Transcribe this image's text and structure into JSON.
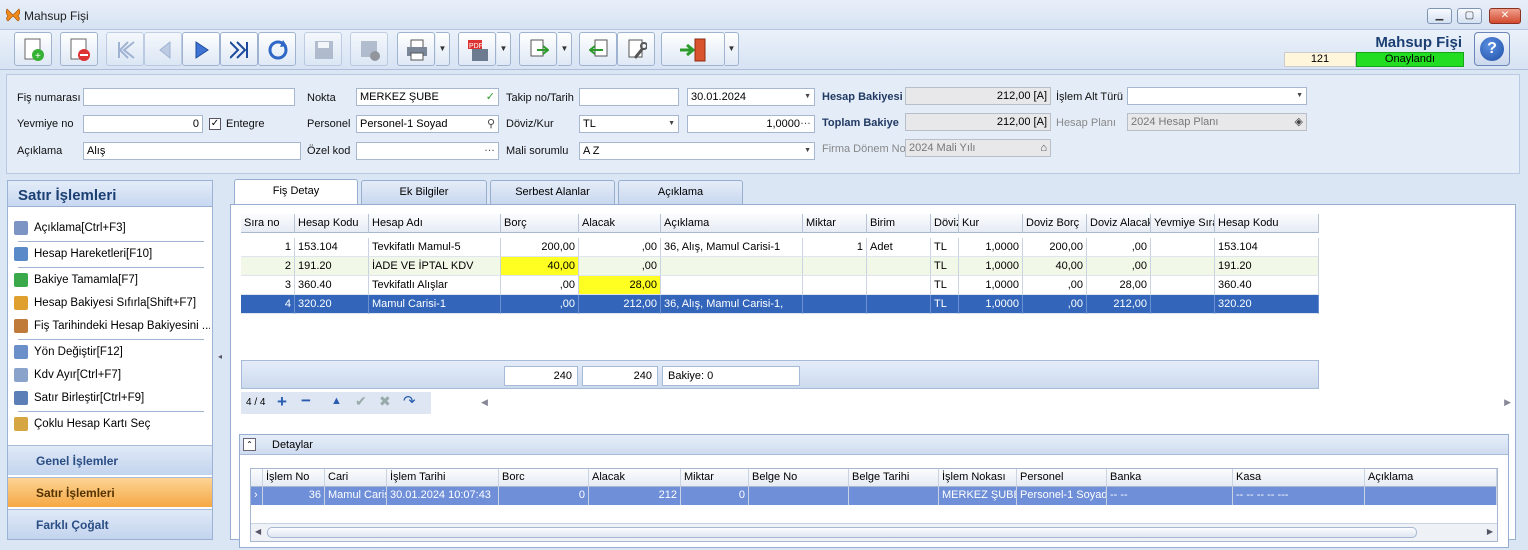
{
  "window": {
    "title": "Mahsup Fişi"
  },
  "form": {
    "title": "Mahsup Fişi",
    "number": "121",
    "status": "Onaylandı"
  },
  "fields": {
    "fis_no_label": "Fiş numarası",
    "fis_no": "",
    "yevmiye_label": "Yevmiye no",
    "yevmiye": "0",
    "entegre_label": "Entegre",
    "aciklama_label": "Açıklama",
    "aciklama": "Alış",
    "nokta_label": "Nokta",
    "nokta": "MERKEZ ŞUBE",
    "personel_label": "Personel",
    "personel": "Personel-1 Soyad",
    "ozel_kod_label": "Özel kod",
    "ozel_kod": "",
    "takip_label": "Takip no/Tarih",
    "takip_no": "",
    "tarih": "30.01.2024",
    "doviz_label": "Döviz/Kur",
    "doviz": "TL",
    "kur": "1,0000",
    "mali_label": "Mali sorumlu",
    "mali": "A Z",
    "hesap_bakiyesi_label": "Hesap Bakiyesi",
    "hesap_bakiyesi": "212,00 [A]",
    "toplam_bakiye_label": "Toplam Bakiye",
    "toplam_bakiye": "212,00 [A]",
    "firma_donem_label": "Firma Dönem No",
    "firma_donem": "2024 Mali Yılı",
    "islem_alt_label": "İşlem Alt Türü",
    "islem_alt": "",
    "hesap_plani_label": "Hesap Planı",
    "hesap_plani": "2024 Hesap Planı"
  },
  "left_panel": {
    "title": "Satır İşlemleri",
    "items": [
      "Açıklama[Ctrl+F3]",
      "Hesap Hareketleri[F10]",
      "Bakiye Tamamla[F7]",
      "Hesap Bakiyesi Sıfırla[Shift+F7]",
      "Fiş Tarihindeki Hesap Bakiyesini ...",
      "Yön Değiştir[F12]",
      "Kdv Ayır[Ctrl+F7]",
      "Satır Birleştir[Ctrl+F9]",
      "Çoklu Hesap Kartı Seç"
    ],
    "nav": [
      "Genel İşlemler",
      "Satır İşlemleri",
      "Farklı Çoğalt"
    ]
  },
  "tabs": [
    "Fiş Detay",
    "Ek Bilgiler",
    "Serbest Alanlar",
    "Açıklama"
  ],
  "grid": {
    "headers": [
      "Sıra no",
      "Hesap Kodu",
      "Hesap Adı",
      "Borç",
      "Alacak",
      "Açıklama",
      "Miktar",
      "Birim",
      "Döviz",
      "Kur",
      "Doviz Borç",
      "Doviz Alacak",
      "Yevmiye Sıra",
      "Hesap Kodu"
    ],
    "rows": [
      [
        "1",
        "153.104",
        "Tevkifatlı Mamul-5",
        "200,00",
        ",00",
        "36, Alış, Mamul Carisi-1",
        "1",
        "Adet",
        "TL",
        "1,0000",
        "200,00",
        ",00",
        "",
        "153.104"
      ],
      [
        "2",
        "191.20",
        "İADE VE İPTAL KDV",
        "40,00",
        ",00",
        "",
        "",
        "",
        "TL",
        "1,0000",
        "40,00",
        ",00",
        "",
        "191.20"
      ],
      [
        "3",
        "360.40",
        "Tevkifatlı Alışlar",
        ",00",
        "28,00",
        "",
        "",
        "",
        "TL",
        "1,0000",
        ",00",
        "28,00",
        "",
        "360.40"
      ],
      [
        "4",
        "320.20",
        "Mamul Carisi-1",
        ",00",
        "212,00",
        "36, Alış, Mamul Carisi-1,",
        "",
        "",
        "TL",
        "1,0000",
        ",00",
        "212,00",
        "",
        "320.20"
      ]
    ],
    "total_borc": "240",
    "total_alacak": "240",
    "bakiye": "Bakiye: 0",
    "record_count": "4 / 4"
  },
  "details": {
    "title": "Detaylar",
    "headers": [
      "İşlem No",
      "Cari",
      "İşlem Tarihi",
      "Borc",
      "Alacak",
      "Miktar",
      "Belge No",
      "Belge Tarihi",
      "İşlem Nokası",
      "Personel",
      "Banka",
      "Kasa",
      "Açıklama"
    ],
    "row": [
      "36",
      "Mamul Caris",
      "30.01.2024 10:07:43",
      "0",
      "212",
      "0",
      "",
      "",
      "MERKEZ ŞUBE",
      "Personel-1 Soyad",
      "-- --",
      "-- -- -- -- ---",
      ""
    ]
  },
  "colors": {
    "accent": "#3366bb",
    "status": "#22dd22",
    "highlight": "#ffff22",
    "nav_active": "#f6a844"
  }
}
